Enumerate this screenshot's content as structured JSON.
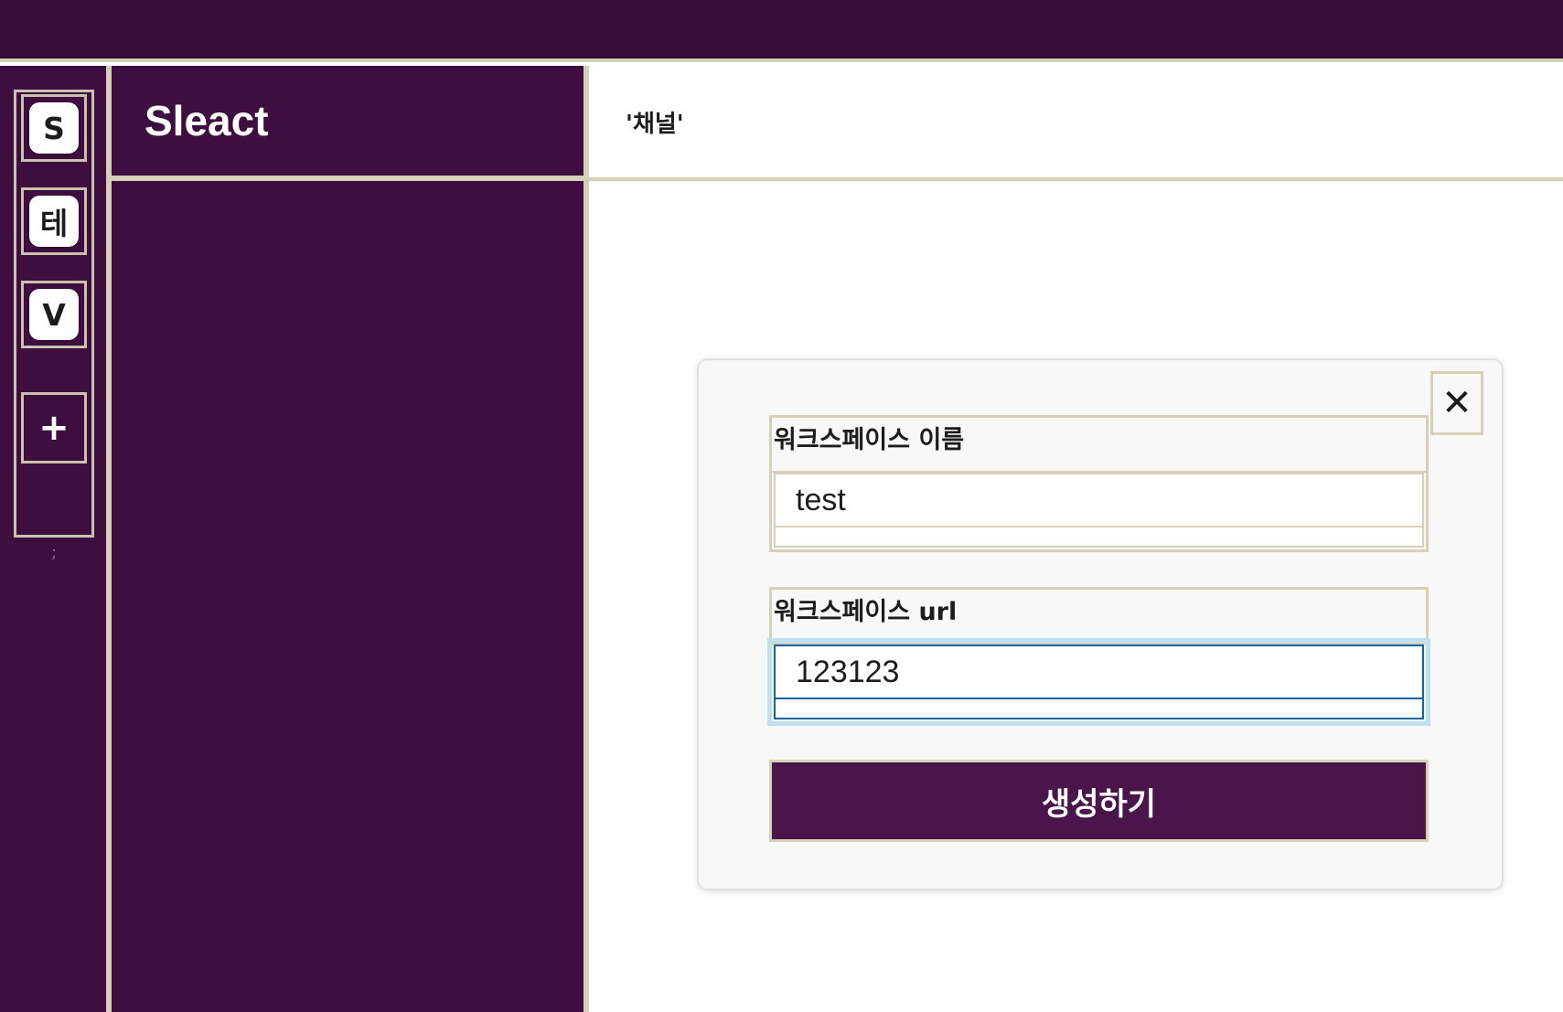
{
  "workspace_rail": {
    "workspaces": [
      {
        "label": "S"
      },
      {
        "label": "테"
      },
      {
        "label": "V"
      }
    ],
    "add_label": "+",
    "separator": ";"
  },
  "channel_sidebar": {
    "workspace_name": "Sleact"
  },
  "main": {
    "channel_title": "'채널'"
  },
  "modal": {
    "close_label": "✕",
    "fields": [
      {
        "label": "워크스페이스 이름",
        "value": "test"
      },
      {
        "label": "워크스페이스 url",
        "value": "123123"
      }
    ],
    "submit_label": "생성하기"
  },
  "colors": {
    "header": "#350d36",
    "sidebar": "#3f0e40",
    "button": "#4a154b",
    "border": "#d6d0b8"
  }
}
